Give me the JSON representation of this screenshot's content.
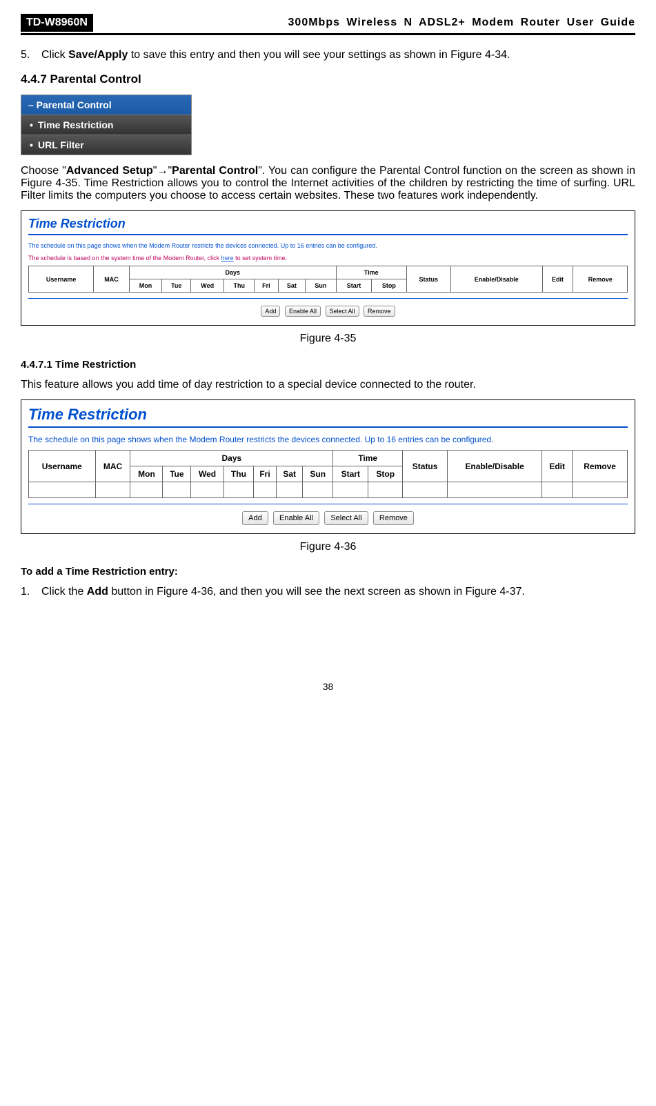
{
  "header": {
    "model": "TD-W8960N",
    "title": "300Mbps Wireless N ADSL2+ Modem Router User Guide"
  },
  "step5": {
    "num": "5.",
    "pre": "Click ",
    "bold": "Save/Apply",
    "post": " to save this entry and then you will see your settings as shown in Figure 4-34."
  },
  "section447": "4.4.7    Parental Control",
  "nav": {
    "title": "– Parental Control",
    "items": [
      "Time Restriction",
      "URL Filter"
    ]
  },
  "intro": {
    "a": "Choose \"",
    "b": "Advanced Setup",
    "c": "\"→\"",
    "d": "Parental Control",
    "e": "\". You can configure the Parental Control function on the screen as shown in Figure 4-35. Time Restriction allows you to control the Internet activities of the children by restricting the time of surfing. URL Filter limits the computers you choose to access certain websites. These two features work independently."
  },
  "shot": {
    "title": "Time Restriction",
    "note1": "The schedule on this page shows when the Modem Router restricts the devices connected. Up to 16 entries can be configured.",
    "note2a": "The schedule is based on the system time of the Modem Router, click ",
    "note2link": "here",
    "note2b": " to set system time.",
    "cols": {
      "user": "Username",
      "mac": "MAC",
      "days": "Days",
      "time": "Time",
      "mon": "Mon",
      "tue": "Tue",
      "wed": "Wed",
      "thu": "Thu",
      "fri": "Fri",
      "sat": "Sat",
      "sun": "Sun",
      "start": "Start",
      "stop": "Stop",
      "status": "Status",
      "enable": "Enable/Disable",
      "edit": "Edit",
      "remove": "Remove"
    },
    "btns": {
      "add": "Add",
      "enableall": "Enable All",
      "selectall": "Select All",
      "remove": "Remove"
    }
  },
  "cap35": "Figure 4-35",
  "sec44711": "4.4.7.1   Time Restriction",
  "timerestr_para": "This feature allows you add time of day restriction to a special device connected to the router.",
  "cap36": "Figure 4-36",
  "addentry_h": "To add a Time Restriction entry:",
  "step1": {
    "num": "1.",
    "a": "Click the ",
    "b": "Add",
    "c": " button in Figure 4-36, and then you will see the next screen as shown in Figure 4-37."
  },
  "page": "38"
}
